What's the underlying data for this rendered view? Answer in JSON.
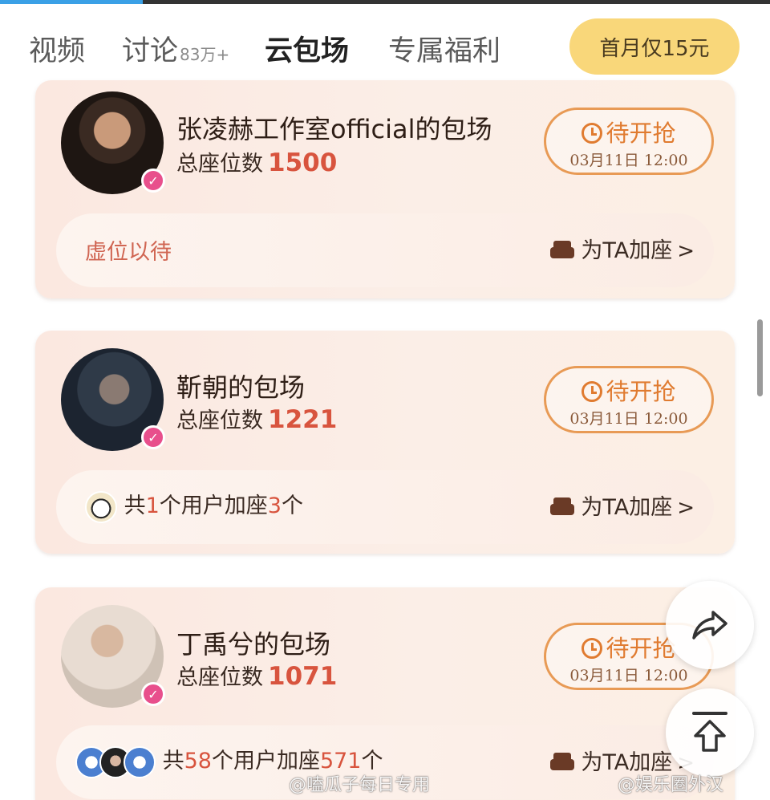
{
  "tabs": [
    {
      "label": "视频",
      "badge": ""
    },
    {
      "label": "讨论",
      "badge": "83万+"
    },
    {
      "label": "云包场",
      "badge": ""
    },
    {
      "label": "专属福利",
      "badge": ""
    }
  ],
  "promo_label": "首月仅15元",
  "seat_label": "总座位数",
  "wait_label": "待开抢",
  "add_seat_label": "为TA加座",
  "cards": [
    {
      "title": "张凌赫工作室official的包场",
      "seats": "1500",
      "time": "03月11日 12:00",
      "footer": "虚位以待"
    },
    {
      "title": "靳朝的包场",
      "seats": "1221",
      "time": "03月11日 12:00",
      "footer_pre": "共",
      "footer_users": "1",
      "footer_mid": "个用户加座",
      "footer_count": "3",
      "footer_post": "个"
    },
    {
      "title": "丁禹兮的包场",
      "seats": "1071",
      "time": "03月11日 12:00",
      "footer_pre": "共",
      "footer_users": "58",
      "footer_mid": "个用户加座",
      "footer_count": "571",
      "footer_post": "个"
    }
  ],
  "watermarks": [
    "@嗑瓜子每日专用",
    "@娱乐圈外汉"
  ],
  "icons": {
    "verified": "verified-badge-icon",
    "clock": "clock-icon",
    "sofa": "sofa-icon",
    "share": "share-icon",
    "top": "back-to-top-icon"
  },
  "colors": {
    "accent": "#d8543e",
    "button_border": "#e89a55",
    "promo_bg": "#f9d77a",
    "verified": "#e84f8c"
  }
}
